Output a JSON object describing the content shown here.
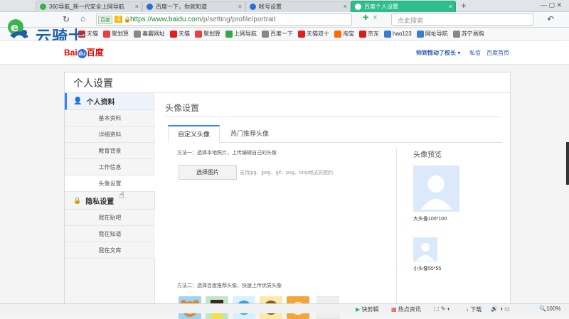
{
  "browser": {
    "tabs": [
      {
        "label": "360导航_新一代安全上网导航",
        "icon_color": "#38b24a"
      },
      {
        "label": "百度一下，你就知道",
        "icon_color": "#2f6cd9"
      },
      {
        "label": "帐号设置",
        "icon_color": "#2f6cd9"
      },
      {
        "label": "百度个人设置",
        "icon_color": "#ffffff"
      }
    ],
    "new_tab": "+",
    "address": {
      "badge": "百度",
      "badge2": "证",
      "url_host": "https://www.baidu.com",
      "url_path": "/p/setting/profile/portrait"
    },
    "search_placeholder": "点此搜索",
    "bookmarks": [
      {
        "label": "天猫",
        "color": "#e02020"
      },
      {
        "label": "聚划算",
        "color": "#e84040"
      },
      {
        "label": "毒霸网址",
        "color": "#888888"
      },
      {
        "label": "天猫",
        "color": "#e02020"
      },
      {
        "label": "聚划算",
        "color": "#e84040"
      },
      {
        "label": "上网导航",
        "color": "#3aa54a"
      },
      {
        "label": "百度一下",
        "color": "#888888"
      },
      {
        "label": "天猫双十",
        "color": "#e02020"
      },
      {
        "label": "淘宝",
        "color": "#ff6a00"
      },
      {
        "label": "京东",
        "color": "#d71c1e"
      },
      {
        "label": "hao123",
        "color": "#3a7bd5"
      },
      {
        "label": "网址导航",
        "color": "#3a7bd5"
      },
      {
        "label": "苏宁易购",
        "color": "#888888"
      }
    ],
    "watermark": "云骑士"
  },
  "header": {
    "logo_text": "百度",
    "user": "帅到惊动了校长",
    "links": [
      "私信",
      "百度首页"
    ]
  },
  "card": {
    "title": "个人设置",
    "sidebar": {
      "section1": "个人资料",
      "items1": [
        "基本资料",
        "详细资料",
        "教育背景",
        "工作信息",
        "头像设置"
      ],
      "section2": "隐私设置",
      "items2": [
        "我在贴吧",
        "我在知道",
        "我在文库"
      ]
    },
    "main": {
      "title": "头像设置",
      "tabs": [
        "自定义头像",
        "热门推荐头像"
      ],
      "method1": "方法一：选择本地照片，上传编辑自己的头像",
      "choose_btn": "选择图片",
      "support": "支持jpg、jpeg、gif、png、bmp格式的图片",
      "method2": "方法二：选择百度推荐头像，快速上传优质头像",
      "more": "更多>",
      "preview_title": "头像预览",
      "big_label": "大头像100*100",
      "small_label": "小头像55*55"
    }
  },
  "statusbar": {
    "items": [
      "快剪辑",
      "热点资讯",
      "下载",
      "100%"
    ]
  }
}
